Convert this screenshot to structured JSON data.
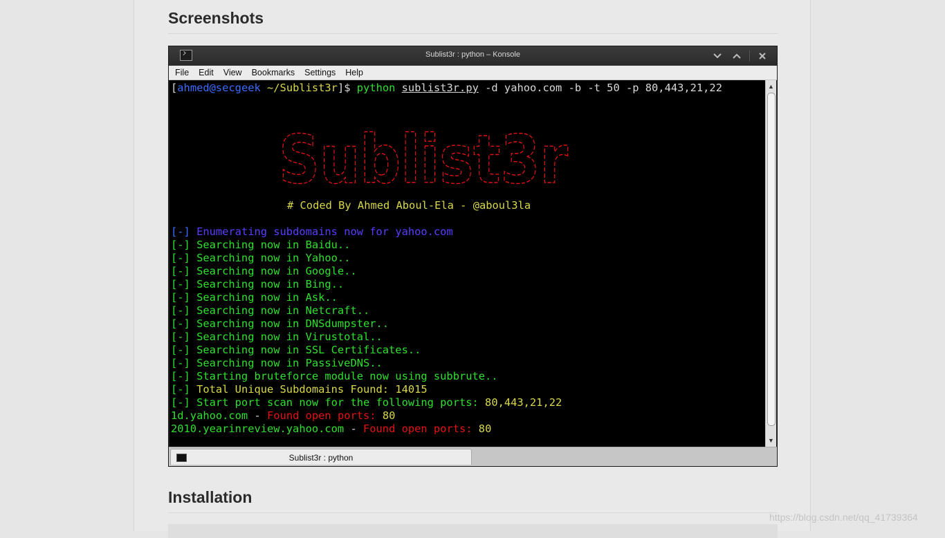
{
  "page": {
    "screenshots_heading": "Screenshots",
    "installation_heading": "Installation",
    "watermark": "https://blog.csdn.net/qq_41739364"
  },
  "window": {
    "title": "Sublist3r : python – Konsole",
    "menu": [
      "File",
      "Edit",
      "View",
      "Bookmarks",
      "Settings",
      "Help"
    ],
    "tab_label": "Sublist3r : python"
  },
  "terminal": {
    "prompt": {
      "bracket_open": "[",
      "user_host": "ahmed@secgeek",
      "path": " ~/Sublist3r",
      "bracket_close": "]$ ",
      "python": "python",
      "script": "sublist3r.py",
      "args": " -d yahoo.com -b -t 50 -p 80,443,21,22"
    },
    "banner_word": "Sublist3r",
    "coded_by": "# Coded By Ahmed Aboul-Ela - @aboul3la",
    "enum_prefix": "[-] ",
    "enum_text": "Enumerating subdomains now for yahoo.com",
    "search_lines": [
      "[-] Searching now in Baidu..",
      "[-] Searching now in Yahoo..",
      "[-] Searching now in Google..",
      "[-] Searching now in Bing..",
      "[-] Searching now in Ask..",
      "[-] Searching now in Netcraft..",
      "[-] Searching now in DNSdumpster..",
      "[-] Searching now in Virustotal..",
      "[-] Searching now in SSL Certificates..",
      "[-] Searching now in PassiveDNS..",
      "[-] Starting bruteforce module now using subbrute.."
    ],
    "total_prefix": "[-] ",
    "total_text": "Total Unique Subdomains Found: 14015",
    "portscan_text": "[-] Start port scan now for the following ports: ",
    "portscan_ports": "80,443,21,22",
    "results": [
      {
        "host": "1d.yahoo.com",
        "dash": " - ",
        "found": "Found open ports: ",
        "ports": "80"
      },
      {
        "host": "2010.yearinreview.yahoo.com",
        "dash": " - ",
        "found": "Found open ports: ",
        "ports": "80"
      }
    ]
  },
  "colors": {
    "terminal_green": "#2ee02e",
    "banner_red": "#e41212",
    "yellow": "#d8d84a",
    "purple": "#5b3dff"
  }
}
